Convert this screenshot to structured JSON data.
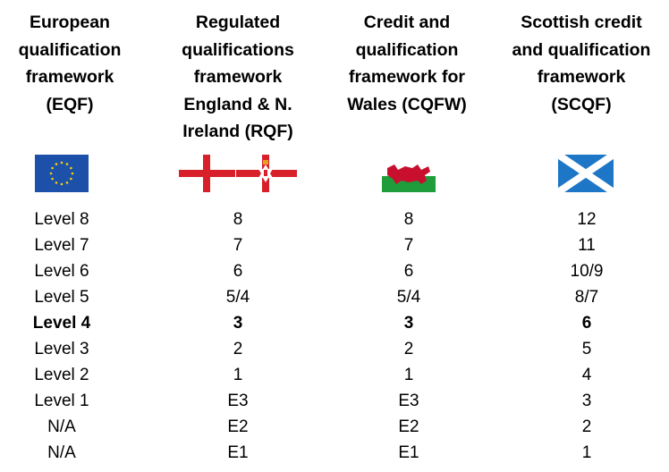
{
  "columns": [
    {
      "key": "eqf",
      "header": "European qualification framework (EQF)",
      "header_lines": [
        "European",
        "qualification",
        "framework",
        "(EQF)"
      ],
      "flag": "eu-flag"
    },
    {
      "key": "rqf",
      "header": "Regulated qualifications framework England & N. Ireland (RQF)",
      "header_lines": [
        "Regulated",
        "qualifications",
        "framework",
        "England & N.",
        "Ireland (RQF)"
      ],
      "flag": "england-and-northern-ireland-flags"
    },
    {
      "key": "cqfw",
      "header": "Credit and qualification framework for Wales (CQFW)",
      "header_lines": [
        "Credit and",
        "qualification",
        "framework for",
        "Wales (CQFW)"
      ],
      "flag": "wales-flag"
    },
    {
      "key": "scqf",
      "header": "Scottish credit and qualification framework (SCQF)",
      "header_lines": [
        "Scottish credit",
        "and qualification",
        "framework",
        "(SCQF)"
      ],
      "flag": "scotland-flag"
    }
  ],
  "rows": [
    {
      "cells": [
        "Level 8",
        "8",
        "8",
        "12"
      ],
      "bold": false
    },
    {
      "cells": [
        "Level 7",
        "7",
        "7",
        "11"
      ],
      "bold": false
    },
    {
      "cells": [
        "Level 6",
        "6",
        "6",
        "10/9"
      ],
      "bold": false
    },
    {
      "cells": [
        "Level 5",
        "5/4",
        "5/4",
        "8/7"
      ],
      "bold": false
    },
    {
      "cells": [
        "Level 4",
        "3",
        "3",
        "6"
      ],
      "bold": true
    },
    {
      "cells": [
        "Level 3",
        "2",
        "2",
        "5"
      ],
      "bold": false
    },
    {
      "cells": [
        "Level 2",
        "1",
        "1",
        "4"
      ],
      "bold": false
    },
    {
      "cells": [
        "Level 1",
        "E3",
        "E3",
        "3"
      ],
      "bold": false
    },
    {
      "cells": [
        "N/A",
        "E2",
        "E2",
        "2"
      ],
      "bold": false
    },
    {
      "cells": [
        "N/A",
        "E1",
        "E1",
        "1"
      ],
      "bold": false
    }
  ],
  "colors": {
    "eu_blue": "#1d50a8",
    "eu_star": "#f5d400",
    "st_george_red": "#d8202a",
    "wales_green": "#1f9c3c",
    "wales_red": "#c8102e",
    "saltire_blue": "#1e76c6"
  }
}
